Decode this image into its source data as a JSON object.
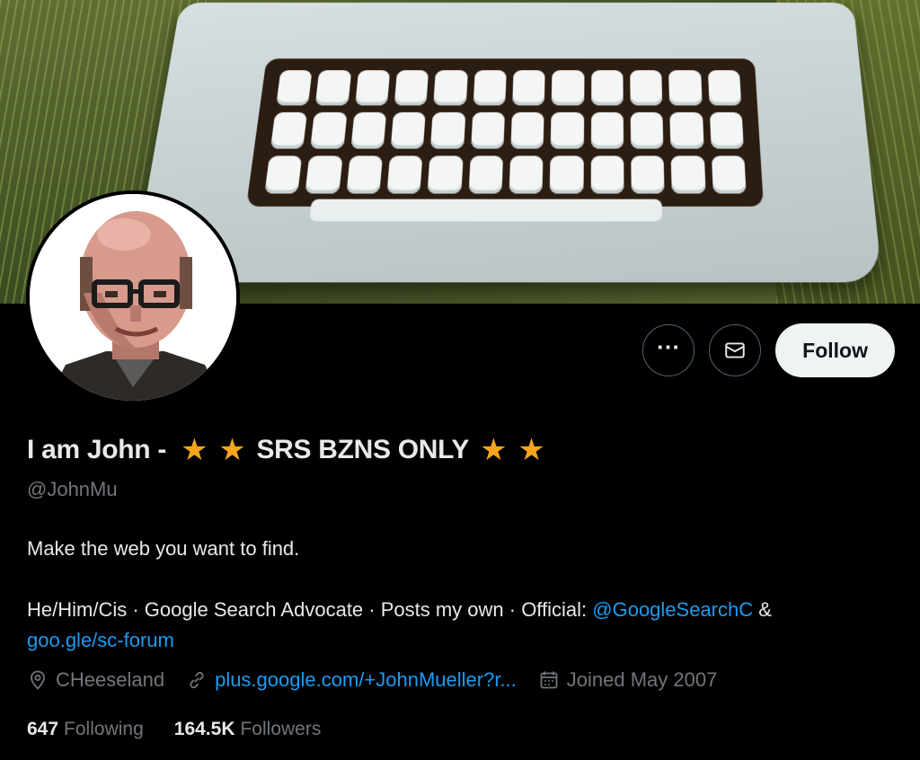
{
  "profile": {
    "name_part1": "I am John -",
    "name_part2": "SRS BZNS ONLY",
    "star_glyph": "★",
    "handle": "@JohnMu",
    "bio_line1": "Make the web you want to find.",
    "bio_line2_prefix": "He/Him/Cis · Google Search Advocate · Posts my own · Official: ",
    "bio_line2_mention": "@GoogleSearchC",
    "bio_line2_amp": " &",
    "bio_link": "goo.gle/sc-forum",
    "location": "CHeeseland",
    "website": "plus.google.com/+JohnMueller?r...",
    "joined": "Joined May 2007",
    "following_count": "647",
    "following_label": "Following",
    "followers_count": "164.5K",
    "followers_label": "Followers"
  },
  "actions": {
    "more_glyph": "···",
    "follow_label": "Follow"
  },
  "colors": {
    "accent": "#1d9bf0",
    "star": "#f7a51c",
    "secondary_text": "#71767b"
  },
  "icons": [
    "more-icon",
    "mail-icon",
    "location-icon",
    "link-icon",
    "calendar-icon"
  ]
}
